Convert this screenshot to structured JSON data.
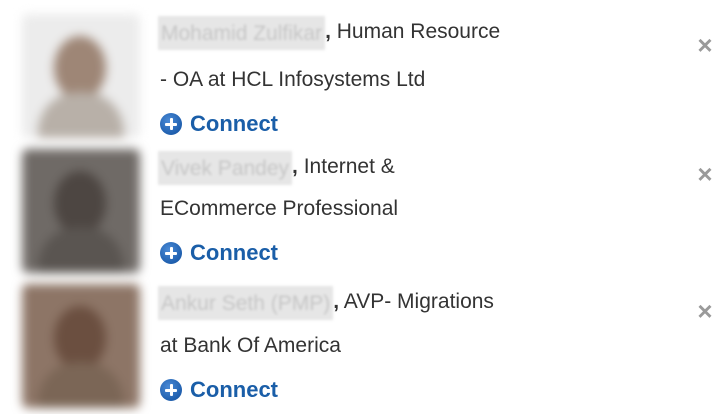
{
  "suggestions": [
    {
      "name": "Mohamid Zulfikar",
      "headline": ", Human Resource - OA at HCL Infosystems Ltd",
      "headline_line1": "Human Resource",
      "headline_line2": "- OA at HCL Infosystems Ltd",
      "connect_label": "Connect",
      "close_icon": "×"
    },
    {
      "name": "Vivek Pandey",
      "headline": ", Internet & ECommerce Professional",
      "headline_line1": "Internet &",
      "headline_line2": "ECommerce Professional",
      "connect_label": "Connect",
      "close_icon": "×"
    },
    {
      "name": "Ankur Seth (PMP)",
      "headline": ", AVP- Migrations at Bank Of America",
      "headline_line1": "AVP- Migrations",
      "headline_line2": "at Bank Of America",
      "connect_label": "Connect",
      "close_icon": "×"
    }
  ],
  "colors": {
    "connect_link": "#1a5ea8",
    "close_icon": "#9a9a9a",
    "text": "#333333"
  }
}
